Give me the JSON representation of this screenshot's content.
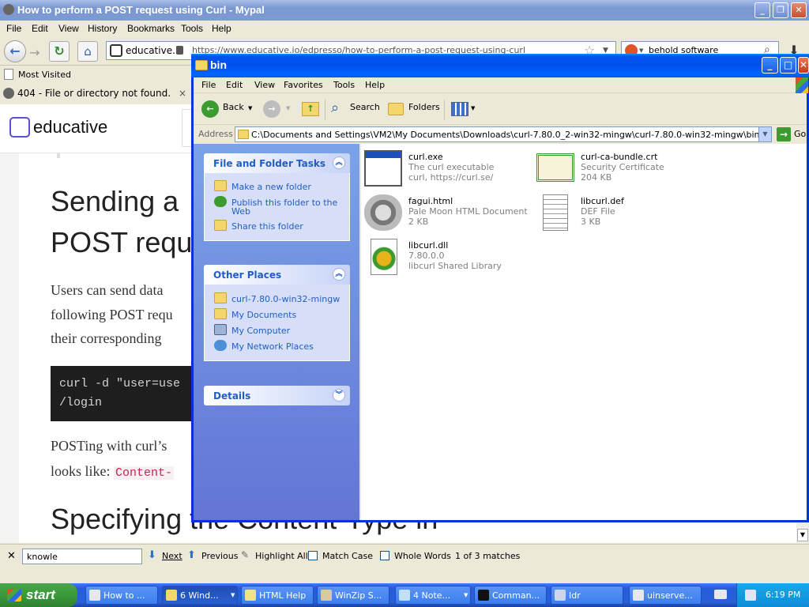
{
  "browser": {
    "title": "How to perform a POST request using Curl - Mypal",
    "menu": [
      "File",
      "Edit",
      "View",
      "History",
      "Bookmarks",
      "Tools",
      "Help"
    ],
    "site_identity": "educative.io",
    "url": "https://www.educative.io/edpresso/how-to-perform-a-post-request-using-curl",
    "search_value": "behold software",
    "bookmark": "Most Visited",
    "tab_label": "404 - File or directory not found.",
    "tab_close": "×"
  },
  "page": {
    "logo": "educative",
    "heading1_line1": "Sending a",
    "heading1_line2": "POST requ",
    "para1_line1": "Users can send data",
    "para1_line2": "following POST requ",
    "para1_line3": "their corresponding",
    "code_line1": "curl -d \"user=use",
    "code_line2": "/login",
    "para2_line1": "POSTing with curl’s",
    "para2_line2_pre": "looks like:",
    "para2_code": "Content-",
    "heading2": "Specifying the Content-Type in"
  },
  "findbar": {
    "query": "knowle",
    "next": "Next",
    "previous": "Previous",
    "highlight_all": "Highlight All",
    "match_case": "Match Case",
    "whole_words": "Whole Words",
    "status": "1 of 3 matches"
  },
  "explorer": {
    "title": "bin",
    "menu": [
      "File",
      "Edit",
      "View",
      "Favorites",
      "Tools",
      "Help"
    ],
    "toolbar": {
      "back": "Back",
      "search": "Search",
      "folders": "Folders"
    },
    "address_label": "Address",
    "address": "C:\\Documents and Settings\\VM2\\My Documents\\Downloads\\curl-7.80.0_2-win32-mingw\\curl-7.80.0-win32-mingw\\bin",
    "go": "Go",
    "tasks_panel": {
      "title": "File and Folder Tasks",
      "items": [
        "Make a new folder",
        "Publish this folder to the",
        "Web",
        "Share this folder"
      ]
    },
    "places_panel": {
      "title": "Other Places",
      "items": [
        "curl-7.80.0-win32-mingw",
        "My Documents",
        "My Computer",
        "My Network Places"
      ]
    },
    "details_panel": {
      "title": "Details"
    },
    "files": [
      {
        "name": "curl.exe",
        "line2": "The curl executable",
        "line3": "curl, https://curl.se/",
        "icon": "exe-window-icon"
      },
      {
        "name": "curl-ca-bundle.crt",
        "line2": "Security Certificate",
        "line3": "204 KB",
        "icon": "certificate-icon"
      },
      {
        "name": "fagui.html",
        "line2": "Pale Moon HTML Document",
        "line3": "2 KB",
        "icon": "raccoon-html-icon"
      },
      {
        "name": "libcurl.def",
        "line2": "DEF File",
        "line3": "3 KB",
        "icon": "text-file-icon"
      },
      {
        "name": "libcurl.dll",
        "line2": "7.80.0.0",
        "line3": "libcurl Shared Library",
        "icon": "dll-gear-icon"
      }
    ]
  },
  "taskbar": {
    "start": "start",
    "buttons": [
      "How to ...",
      "6 Wind...",
      "HTML Help",
      "WinZip S...",
      "4 Note...",
      "Comman...",
      "Idr",
      "uinserve..."
    ],
    "clock": "6:19 PM"
  },
  "colors": {
    "xp_blue": "#0054e3",
    "task_pane": "#6375d6",
    "link_blue": "#215dc6",
    "start_green": "#3b9a3b"
  }
}
